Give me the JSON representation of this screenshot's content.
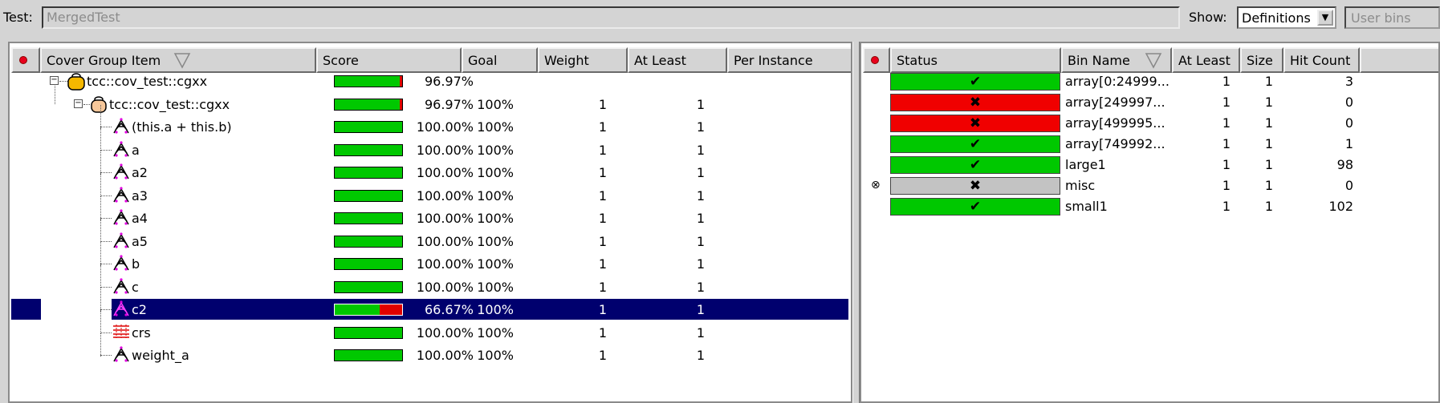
{
  "toolbar": {
    "test_label": "Test:",
    "test_value": "MergedTest",
    "show_label": "Show:",
    "show_value": "Definitions",
    "user_bins_placeholder": "User bins"
  },
  "left_table": {
    "columns": [
      "Cover Group Item",
      "Score",
      "Goal",
      "Weight",
      "At Least",
      "Per Instance"
    ],
    "rows": [
      {
        "name": "tcc::cov_test::cgxx",
        "score": "96.97%",
        "score_frac": 0.97,
        "goal": "",
        "weight": "",
        "at_least": "",
        "icon": "covergroup-type-icon",
        "indent": 0
      },
      {
        "name": "tcc::cov_test::cgxx",
        "score": "96.97%",
        "score_frac": 0.97,
        "goal": "100%",
        "weight": "1",
        "at_least": "1",
        "icon": "covergroup-instance-icon",
        "indent": 1
      },
      {
        "name": "(this.a + this.b)",
        "score": "100.00%",
        "score_frac": 1.0,
        "goal": "100%",
        "weight": "1",
        "at_least": "1",
        "icon": "coverpoint-icon",
        "indent": 2
      },
      {
        "name": "a",
        "score": "100.00%",
        "score_frac": 1.0,
        "goal": "100%",
        "weight": "1",
        "at_least": "1",
        "icon": "coverpoint-icon",
        "indent": 2
      },
      {
        "name": "a2",
        "score": "100.00%",
        "score_frac": 1.0,
        "goal": "100%",
        "weight": "1",
        "at_least": "1",
        "icon": "coverpoint-icon",
        "indent": 2
      },
      {
        "name": "a3",
        "score": "100.00%",
        "score_frac": 1.0,
        "goal": "100%",
        "weight": "1",
        "at_least": "1",
        "icon": "coverpoint-icon",
        "indent": 2
      },
      {
        "name": "a4",
        "score": "100.00%",
        "score_frac": 1.0,
        "goal": "100%",
        "weight": "1",
        "at_least": "1",
        "icon": "coverpoint-icon",
        "indent": 2
      },
      {
        "name": "a5",
        "score": "100.00%",
        "score_frac": 1.0,
        "goal": "100%",
        "weight": "1",
        "at_least": "1",
        "icon": "coverpoint-icon",
        "indent": 2
      },
      {
        "name": "b",
        "score": "100.00%",
        "score_frac": 1.0,
        "goal": "100%",
        "weight": "1",
        "at_least": "1",
        "icon": "coverpoint-icon",
        "indent": 2
      },
      {
        "name": "c",
        "score": "100.00%",
        "score_frac": 1.0,
        "goal": "100%",
        "weight": "1",
        "at_least": "1",
        "icon": "coverpoint-icon",
        "indent": 2
      },
      {
        "name": "c2",
        "score": "66.67%",
        "score_frac": 0.667,
        "goal": "100%",
        "weight": "1",
        "at_least": "1",
        "icon": "coverpoint-icon",
        "indent": 2,
        "selected": true
      },
      {
        "name": "crs",
        "score": "100.00%",
        "score_frac": 1.0,
        "goal": "100%",
        "weight": "1",
        "at_least": "1",
        "icon": "cross-icon",
        "indent": 2
      },
      {
        "name": "weight_a",
        "score": "100.00%",
        "score_frac": 1.0,
        "goal": "100%",
        "weight": "1",
        "at_least": "1",
        "icon": "coverpoint-icon",
        "indent": 2
      }
    ]
  },
  "right_table": {
    "columns": [
      "Status",
      "Bin Name",
      "At Least",
      "Size",
      "Hit Count"
    ],
    "rows": [
      {
        "status": "pass",
        "glyph": "✔",
        "bin": "array[0:24999...",
        "at_least": "1",
        "size": "1",
        "hits": "3",
        "marker": ""
      },
      {
        "status": "fail",
        "glyph": "✖",
        "bin": "array[249997...",
        "at_least": "1",
        "size": "1",
        "hits": "0",
        "marker": ""
      },
      {
        "status": "fail",
        "glyph": "✖",
        "bin": "array[499995...",
        "at_least": "1",
        "size": "1",
        "hits": "0",
        "marker": ""
      },
      {
        "status": "pass",
        "glyph": "✔",
        "bin": "array[749992...",
        "at_least": "1",
        "size": "1",
        "hits": "1",
        "marker": ""
      },
      {
        "status": "pass",
        "glyph": "✔",
        "bin": "large1",
        "at_least": "1",
        "size": "1",
        "hits": "98",
        "marker": ""
      },
      {
        "status": "ign",
        "glyph": "✖",
        "bin": "misc",
        "at_least": "1",
        "size": "1",
        "hits": "0",
        "marker": "⊗"
      },
      {
        "status": "pass",
        "glyph": "✔",
        "bin": "small1",
        "at_least": "1",
        "size": "1",
        "hits": "102",
        "marker": ""
      }
    ]
  },
  "colors": {
    "pass": "#00c800",
    "fail": "#f00000",
    "ignore": "#c3c3c3",
    "selection": "#00006e"
  }
}
